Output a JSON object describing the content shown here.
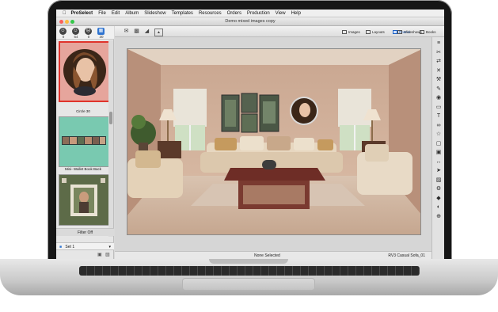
{
  "menubar": {
    "app": "ProSelect",
    "items": [
      "File",
      "Edit",
      "Album",
      "Slideshow",
      "Templates",
      "Resources",
      "Orders",
      "Production",
      "View",
      "Help"
    ]
  },
  "window": {
    "title": "Demo mixed images copy"
  },
  "sidebar": {
    "counts": [
      "0",
      "64",
      "0",
      "30"
    ],
    "thumbs": [
      {
        "caption": "Circle 30"
      },
      {
        "caption": "Mini- Wallet Book Back"
      },
      {
        "caption": ""
      }
    ],
    "filter_label": "Filter Off",
    "set_label": "Set 1"
  },
  "toolbar": {
    "modes": [
      "Images",
      "Layouts",
      "Rooms",
      "Books",
      "Slideshows"
    ],
    "active_mode": "Rooms"
  },
  "status": {
    "selection": "None Selected",
    "room_name": "RV3 Casual Sofa_01"
  },
  "icons": {
    "face_icons": [
      "happy-face-icon",
      "neutral-face-icon",
      "sad-face-icon",
      "grid-icon"
    ],
    "right_tools": [
      "layers-icon",
      "crop-icon",
      "shuffle-icon",
      "trash-icon",
      "wrench-icon",
      "edit-icon",
      "pin-icon",
      "sofa-icon",
      "text-icon",
      "link-icon",
      "lamp-icon",
      "frame-icon",
      "camera-icon",
      "flip-icon",
      "arrow-icon",
      "photo-icon",
      "settings-icon",
      "tag-icon",
      "mask-icon",
      "zoom-icon"
    ]
  },
  "colors": {
    "accent": "#1a5fc4",
    "selected_thumb_border": "#e0332c",
    "thumb2_bg": "#79c9b0",
    "wall": "#d8b9a0"
  }
}
